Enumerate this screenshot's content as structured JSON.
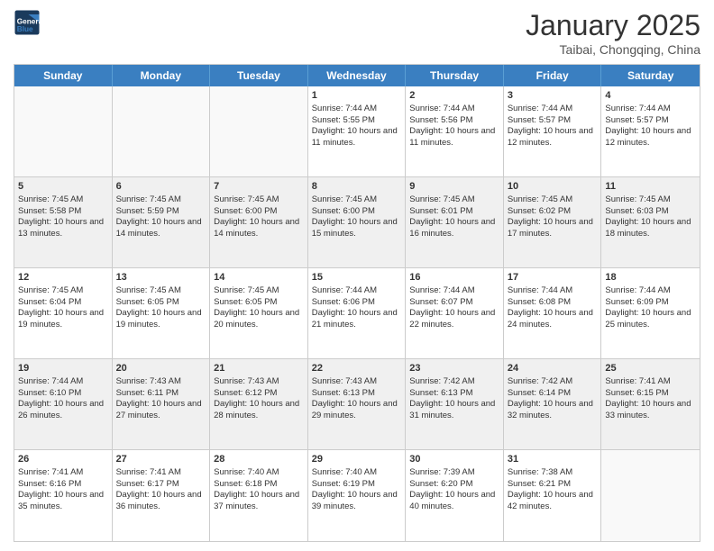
{
  "header": {
    "logo_line1": "General",
    "logo_line2": "Blue",
    "month_title": "January 2025",
    "location": "Taibai, Chongqing, China"
  },
  "days_of_week": [
    "Sunday",
    "Monday",
    "Tuesday",
    "Wednesday",
    "Thursday",
    "Friday",
    "Saturday"
  ],
  "weeks": [
    [
      {
        "day": "",
        "empty": true
      },
      {
        "day": "",
        "empty": true
      },
      {
        "day": "",
        "empty": true
      },
      {
        "day": "1",
        "sunrise": "7:44 AM",
        "sunset": "5:55 PM",
        "daylight": "10 hours and 11 minutes."
      },
      {
        "day": "2",
        "sunrise": "7:44 AM",
        "sunset": "5:56 PM",
        "daylight": "10 hours and 11 minutes."
      },
      {
        "day": "3",
        "sunrise": "7:44 AM",
        "sunset": "5:57 PM",
        "daylight": "10 hours and 12 minutes."
      },
      {
        "day": "4",
        "sunrise": "7:44 AM",
        "sunset": "5:57 PM",
        "daylight": "10 hours and 12 minutes."
      }
    ],
    [
      {
        "day": "5",
        "sunrise": "7:45 AM",
        "sunset": "5:58 PM",
        "daylight": "10 hours and 13 minutes."
      },
      {
        "day": "6",
        "sunrise": "7:45 AM",
        "sunset": "5:59 PM",
        "daylight": "10 hours and 14 minutes."
      },
      {
        "day": "7",
        "sunrise": "7:45 AM",
        "sunset": "6:00 PM",
        "daylight": "10 hours and 14 minutes."
      },
      {
        "day": "8",
        "sunrise": "7:45 AM",
        "sunset": "6:00 PM",
        "daylight": "10 hours and 15 minutes."
      },
      {
        "day": "9",
        "sunrise": "7:45 AM",
        "sunset": "6:01 PM",
        "daylight": "10 hours and 16 minutes."
      },
      {
        "day": "10",
        "sunrise": "7:45 AM",
        "sunset": "6:02 PM",
        "daylight": "10 hours and 17 minutes."
      },
      {
        "day": "11",
        "sunrise": "7:45 AM",
        "sunset": "6:03 PM",
        "daylight": "10 hours and 18 minutes."
      }
    ],
    [
      {
        "day": "12",
        "sunrise": "7:45 AM",
        "sunset": "6:04 PM",
        "daylight": "10 hours and 19 minutes."
      },
      {
        "day": "13",
        "sunrise": "7:45 AM",
        "sunset": "6:05 PM",
        "daylight": "10 hours and 19 minutes."
      },
      {
        "day": "14",
        "sunrise": "7:45 AM",
        "sunset": "6:05 PM",
        "daylight": "10 hours and 20 minutes."
      },
      {
        "day": "15",
        "sunrise": "7:44 AM",
        "sunset": "6:06 PM",
        "daylight": "10 hours and 21 minutes."
      },
      {
        "day": "16",
        "sunrise": "7:44 AM",
        "sunset": "6:07 PM",
        "daylight": "10 hours and 22 minutes."
      },
      {
        "day": "17",
        "sunrise": "7:44 AM",
        "sunset": "6:08 PM",
        "daylight": "10 hours and 24 minutes."
      },
      {
        "day": "18",
        "sunrise": "7:44 AM",
        "sunset": "6:09 PM",
        "daylight": "10 hours and 25 minutes."
      }
    ],
    [
      {
        "day": "19",
        "sunrise": "7:44 AM",
        "sunset": "6:10 PM",
        "daylight": "10 hours and 26 minutes."
      },
      {
        "day": "20",
        "sunrise": "7:43 AM",
        "sunset": "6:11 PM",
        "daylight": "10 hours and 27 minutes."
      },
      {
        "day": "21",
        "sunrise": "7:43 AM",
        "sunset": "6:12 PM",
        "daylight": "10 hours and 28 minutes."
      },
      {
        "day": "22",
        "sunrise": "7:43 AM",
        "sunset": "6:13 PM",
        "daylight": "10 hours and 29 minutes."
      },
      {
        "day": "23",
        "sunrise": "7:42 AM",
        "sunset": "6:13 PM",
        "daylight": "10 hours and 31 minutes."
      },
      {
        "day": "24",
        "sunrise": "7:42 AM",
        "sunset": "6:14 PM",
        "daylight": "10 hours and 32 minutes."
      },
      {
        "day": "25",
        "sunrise": "7:41 AM",
        "sunset": "6:15 PM",
        "daylight": "10 hours and 33 minutes."
      }
    ],
    [
      {
        "day": "26",
        "sunrise": "7:41 AM",
        "sunset": "6:16 PM",
        "daylight": "10 hours and 35 minutes."
      },
      {
        "day": "27",
        "sunrise": "7:41 AM",
        "sunset": "6:17 PM",
        "daylight": "10 hours and 36 minutes."
      },
      {
        "day": "28",
        "sunrise": "7:40 AM",
        "sunset": "6:18 PM",
        "daylight": "10 hours and 37 minutes."
      },
      {
        "day": "29",
        "sunrise": "7:40 AM",
        "sunset": "6:19 PM",
        "daylight": "10 hours and 39 minutes."
      },
      {
        "day": "30",
        "sunrise": "7:39 AM",
        "sunset": "6:20 PM",
        "daylight": "10 hours and 40 minutes."
      },
      {
        "day": "31",
        "sunrise": "7:38 AM",
        "sunset": "6:21 PM",
        "daylight": "10 hours and 42 minutes."
      },
      {
        "day": "",
        "empty": true
      }
    ]
  ],
  "labels": {
    "sunrise": "Sunrise:",
    "sunset": "Sunset:",
    "daylight": "Daylight:"
  }
}
